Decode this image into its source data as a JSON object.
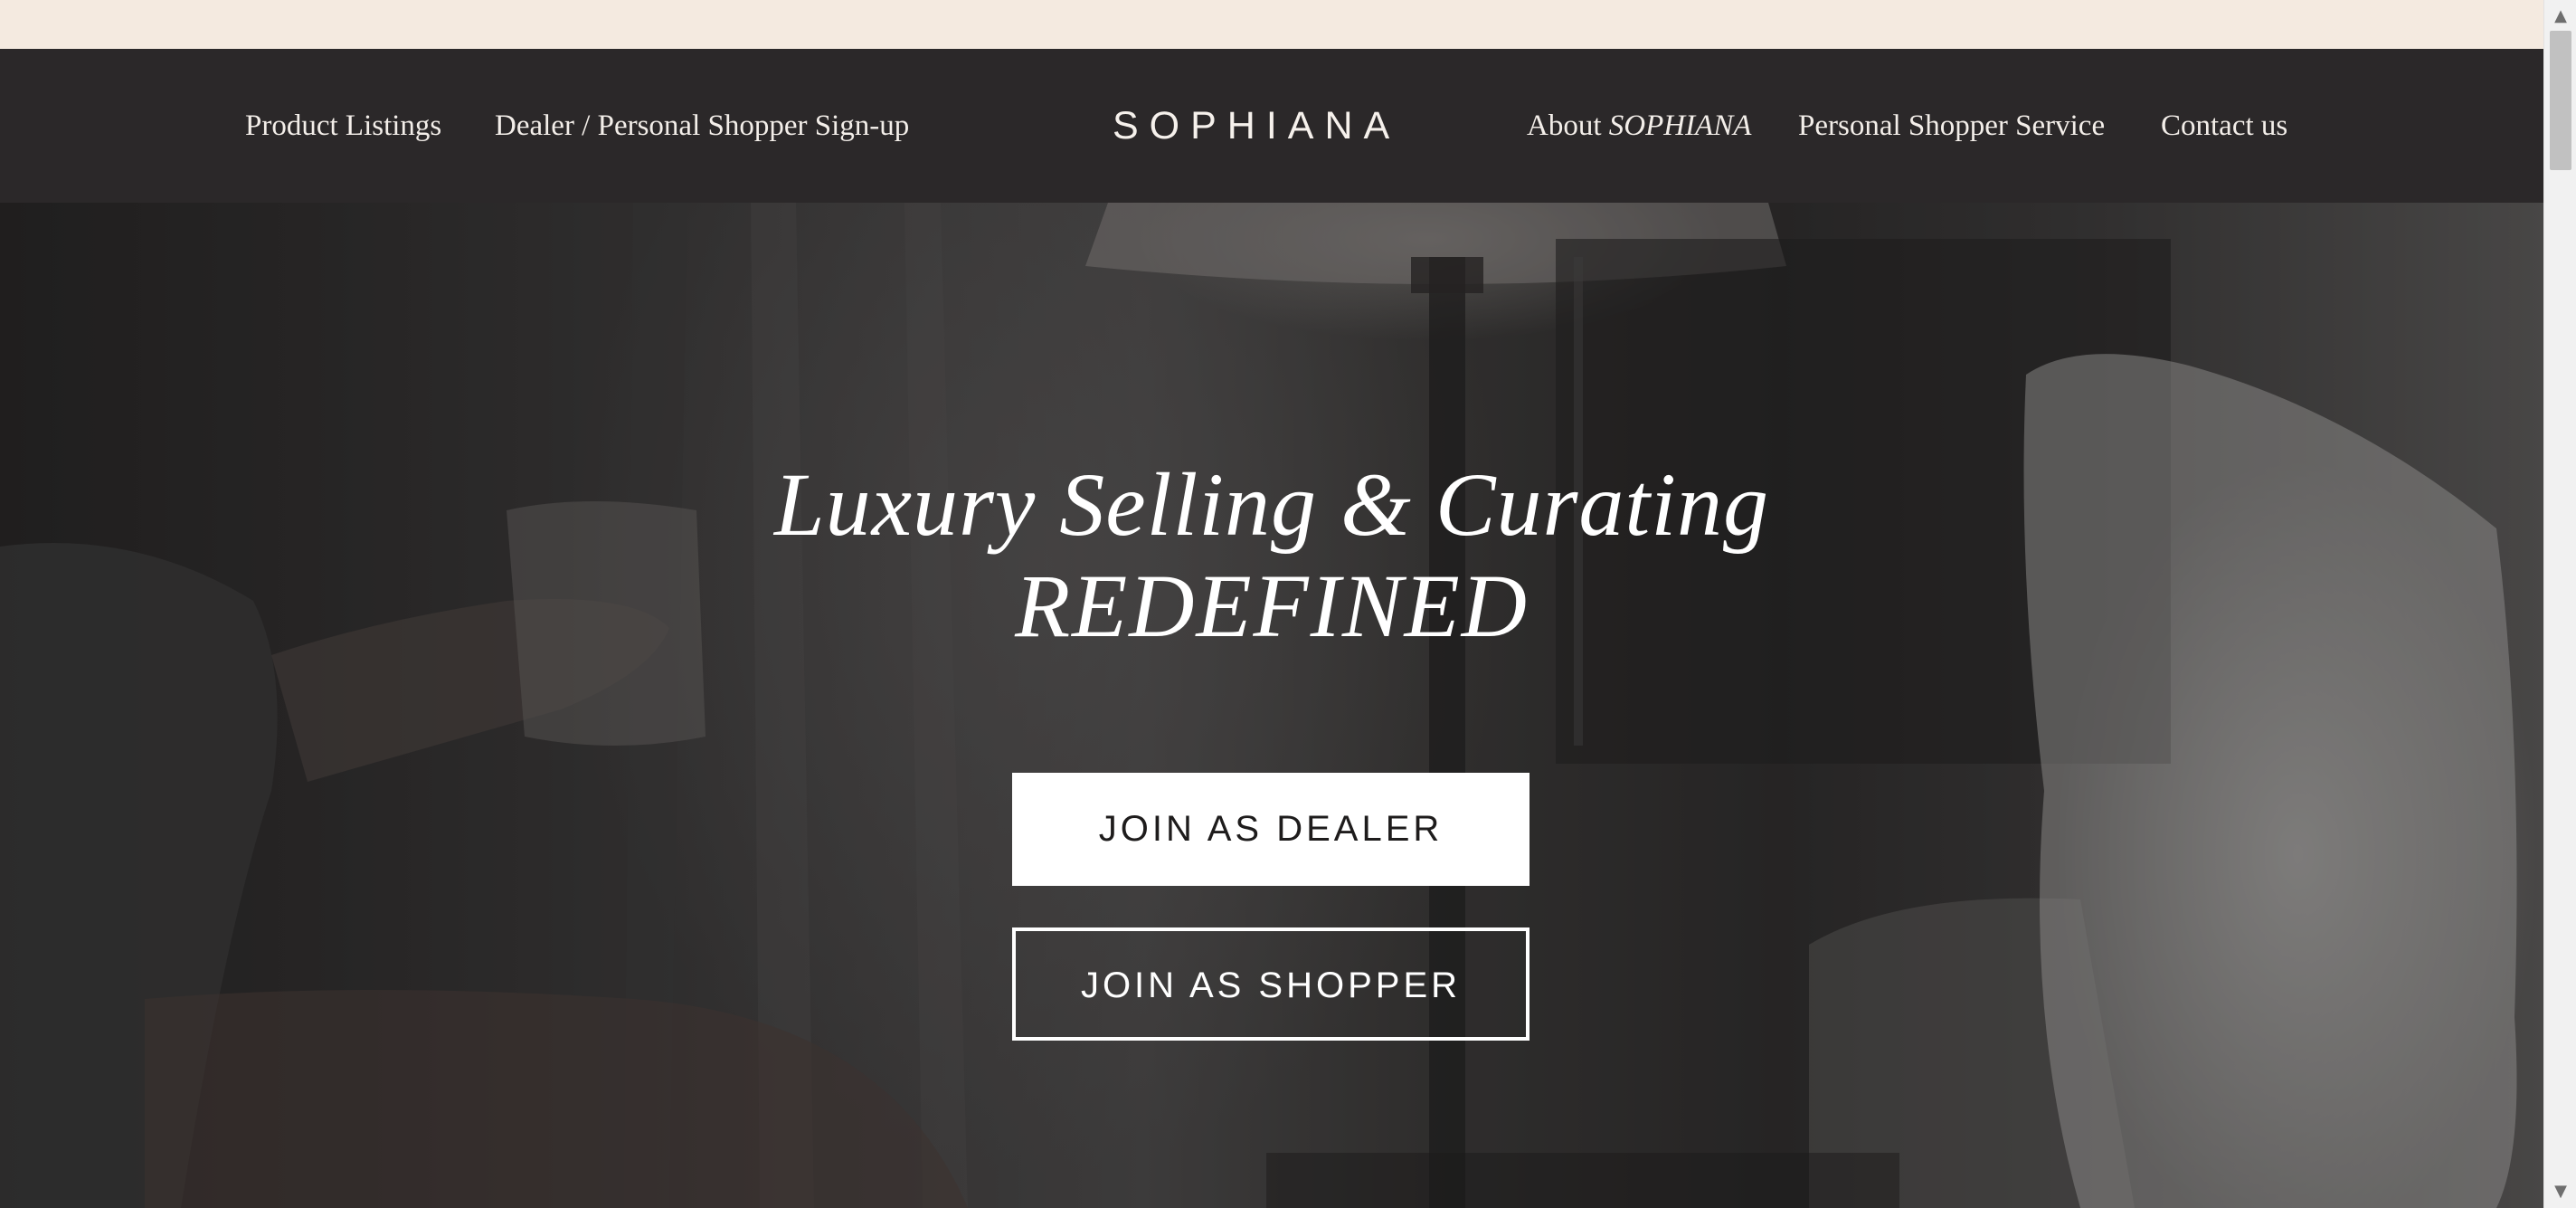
{
  "header": {
    "nav_left": [
      {
        "label": "Product Listings"
      },
      {
        "label": "Dealer / Personal Shopper Sign-up"
      }
    ],
    "brand": "SOPHIANA",
    "nav_right": {
      "about_prefix": "About",
      "about_brand": "SOPHIANA",
      "personal_shopper": "Personal Shopper Service",
      "contact": "Contact us"
    }
  },
  "hero": {
    "title_line1": "Luxury Selling & Curating",
    "title_line2": "REDEFINED",
    "buttons": {
      "dealer": "JOIN AS DEALER",
      "shopper": "JOIN AS SHOPPER"
    }
  },
  "scrollbar": {
    "up_icon": "triangle-up-icon",
    "down_icon": "triangle-down-icon"
  },
  "colors": {
    "top_strip": "#f4eae0",
    "header_bg": "#2b2829",
    "nav_text": "#f3eee9",
    "button_fill": "#ffffff",
    "button_dark_text": "#1e1c1c"
  }
}
